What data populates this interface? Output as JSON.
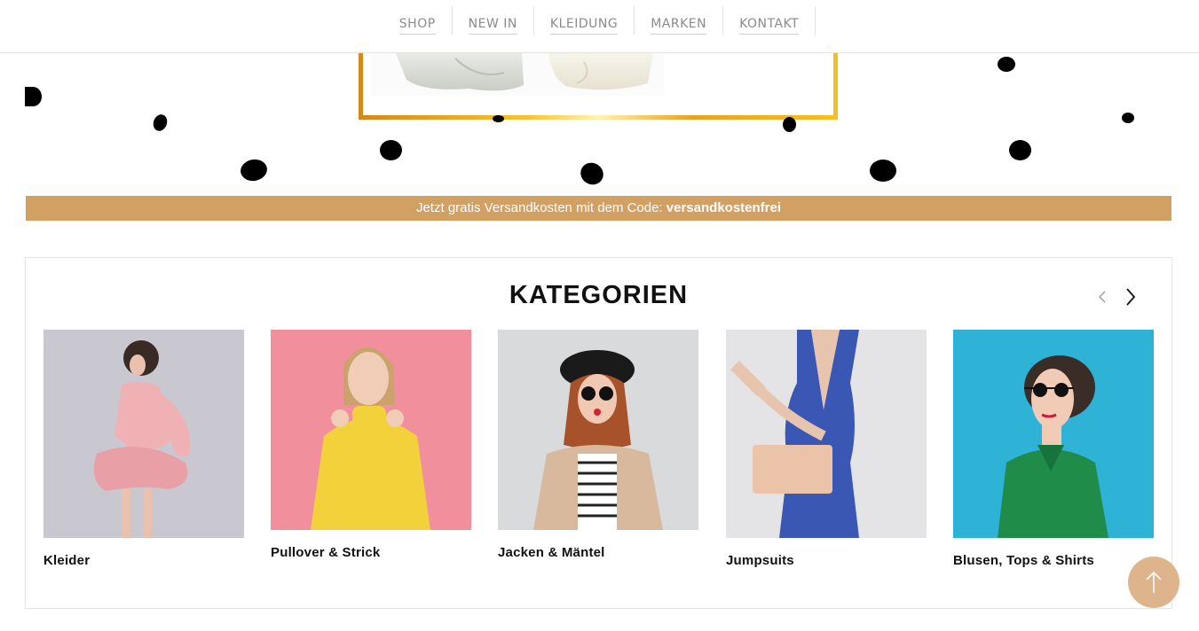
{
  "nav": {
    "items": [
      {
        "label": "SHOP"
      },
      {
        "label": "NEW IN"
      },
      {
        "label": "KLEIDUNG"
      },
      {
        "label": "MARKEN"
      },
      {
        "label": "KONTAKT"
      }
    ]
  },
  "promo": {
    "text": "Jetzt gratis Versandkosten mit dem Code: ",
    "code": "versandkostenfrei"
  },
  "categories": {
    "title": "KATEGORIEN",
    "items": [
      {
        "label": "Kleider",
        "bg": "#c9c8d1"
      },
      {
        "label": "Pullover & Strick",
        "bg": "#f28f9c"
      },
      {
        "label": "Jacken & Mäntel",
        "bg": "#d9dadb"
      },
      {
        "label": "Jumpsuits",
        "bg": "#e4e4e7"
      },
      {
        "label": "Blusen, Tops & Shirts",
        "bg": "#2eb2d6"
      }
    ]
  },
  "colors": {
    "promo_bg": "#d3a064",
    "to_top_bg": "#deb48c",
    "frame_gold": "#f3c020"
  },
  "icons": {
    "prev": "chevron-left-icon",
    "next": "chevron-right-icon",
    "to_top": "arrow-up-icon"
  }
}
